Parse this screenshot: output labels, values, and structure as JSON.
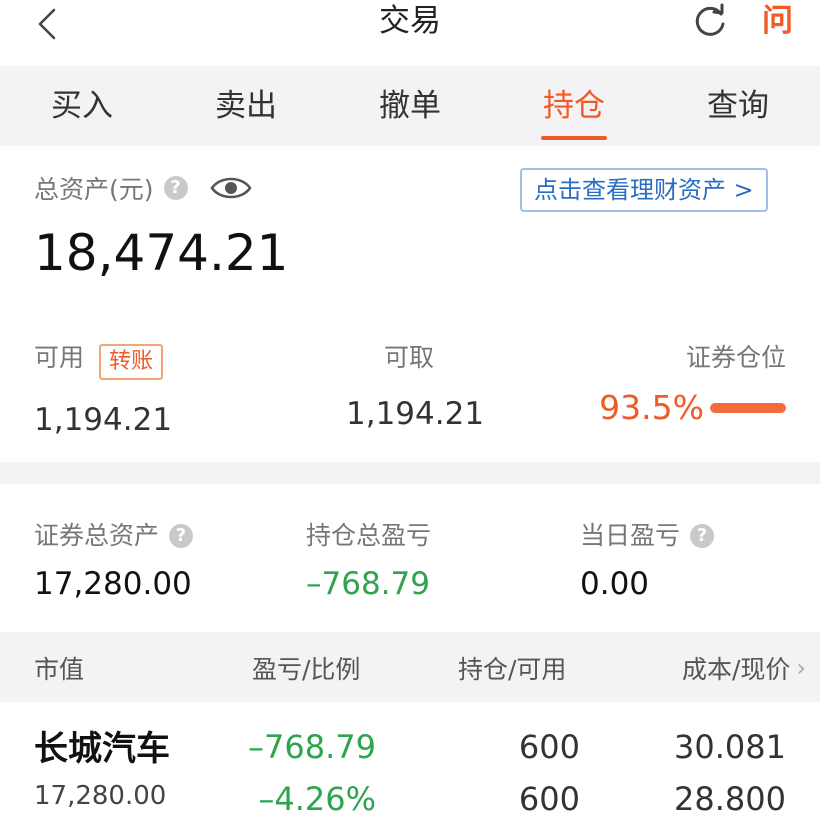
{
  "header": {
    "title": "交易",
    "back_icon": "chevron-left-icon",
    "refresh_icon": "refresh-icon",
    "ask_label": "问"
  },
  "tabs": [
    {
      "label": "买入",
      "active": false
    },
    {
      "label": "卖出",
      "active": false
    },
    {
      "label": "撤单",
      "active": false
    },
    {
      "label": "持仓",
      "active": true
    },
    {
      "label": "查询",
      "active": false
    }
  ],
  "assets": {
    "total_label": "总资产(元)",
    "help_icon": "?",
    "finance_link": "点击查看理财资产 >",
    "total_value": "18,474.21",
    "available_label": "可用",
    "transfer_label": "转账",
    "available_value": "1,194.21",
    "withdrawable_label": "可取",
    "withdrawable_value": "1,194.21",
    "position_label": "证券仓位",
    "position_value": "93.5%",
    "position_fraction": 0.935
  },
  "summary": {
    "securities_total_label": "证券总资产",
    "securities_total_value": "17,280.00",
    "holding_pl_label": "持仓总盈亏",
    "holding_pl_value": "–768.79",
    "daily_pl_label": "当日盈亏",
    "daily_pl_value": "0.00"
  },
  "list_header": {
    "col1": "市值",
    "col2": "盈亏/比例",
    "col3": "持仓/可用",
    "col4": "成本/现价"
  },
  "holdings": [
    {
      "name": "长城汽车",
      "market_value": "17,280.00",
      "pl": "–768.79",
      "pl_pct": "–4.26%",
      "holding": "600",
      "available": "600",
      "cost": "30.081",
      "price": "28.800"
    }
  ],
  "colors": {
    "accent": "#f05a24",
    "loss_green": "#2ea44f",
    "link_blue": "#2b6cc4",
    "section_bg": "#f3f3f5"
  }
}
